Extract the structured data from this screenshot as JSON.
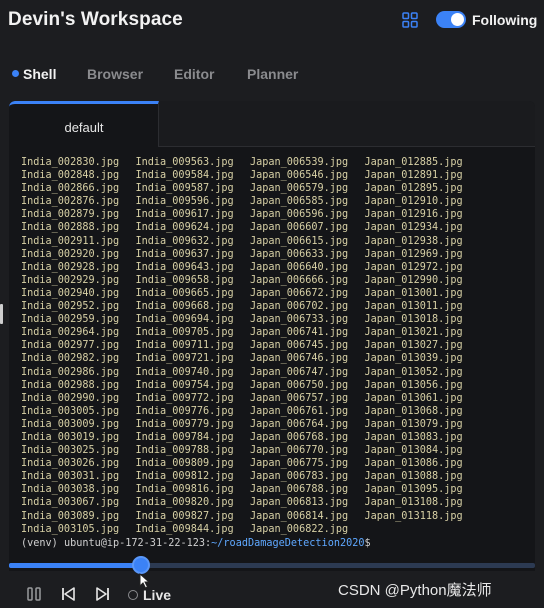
{
  "header": {
    "title": "Devin's Workspace",
    "following_label": "Following",
    "toggle_on": true,
    "icons": {
      "layout": "grid-icon"
    }
  },
  "tabs": [
    {
      "label": "Shell",
      "active": true
    },
    {
      "label": "Browser",
      "active": false
    },
    {
      "label": "Editor",
      "active": false
    },
    {
      "label": "Planner",
      "active": false
    }
  ],
  "terminal": {
    "tab_label": "default",
    "columns": [
      [
        "India_002830.jpg",
        "India_002848.jpg",
        "India_002866.jpg",
        "India_002876.jpg",
        "India_002879.jpg",
        "India_002888.jpg",
        "India_002911.jpg",
        "India_002920.jpg",
        "India_002928.jpg",
        "India_002929.jpg",
        "India_002940.jpg",
        "India_002952.jpg",
        "India_002959.jpg",
        "India_002964.jpg",
        "India_002977.jpg",
        "India_002982.jpg",
        "India_002986.jpg",
        "India_002988.jpg",
        "India_002990.jpg",
        "India_003005.jpg",
        "India_003009.jpg",
        "India_003019.jpg",
        "India_003025.jpg",
        "India_003026.jpg",
        "India_003031.jpg",
        "India_003038.jpg",
        "India_003067.jpg",
        "India_003089.jpg",
        "India_003105.jpg"
      ],
      [
        "India_009563.jpg",
        "India_009584.jpg",
        "India_009587.jpg",
        "India_009596.jpg",
        "India_009617.jpg",
        "India_009624.jpg",
        "India_009632.jpg",
        "India_009637.jpg",
        "India_009643.jpg",
        "India_009658.jpg",
        "India_009665.jpg",
        "India_009668.jpg",
        "India_009694.jpg",
        "India_009705.jpg",
        "India_009711.jpg",
        "India_009721.jpg",
        "India_009740.jpg",
        "India_009754.jpg",
        "India_009772.jpg",
        "India_009776.jpg",
        "India_009779.jpg",
        "India_009784.jpg",
        "India_009788.jpg",
        "India_009809.jpg",
        "India_009812.jpg",
        "India_009816.jpg",
        "India_009820.jpg",
        "India_009827.jpg",
        "India_009844.jpg"
      ],
      [
        "Japan_006539.jpg",
        "Japan_006546.jpg",
        "Japan_006579.jpg",
        "Japan_006585.jpg",
        "Japan_006596.jpg",
        "Japan_006607.jpg",
        "Japan_006615.jpg",
        "Japan_006633.jpg",
        "Japan_006640.jpg",
        "Japan_006666.jpg",
        "Japan_006672.jpg",
        "Japan_006702.jpg",
        "Japan_006733.jpg",
        "Japan_006741.jpg",
        "Japan_006745.jpg",
        "Japan_006746.jpg",
        "Japan_006747.jpg",
        "Japan_006750.jpg",
        "Japan_006757.jpg",
        "Japan_006761.jpg",
        "Japan_006764.jpg",
        "Japan_006768.jpg",
        "Japan_006770.jpg",
        "Japan_006775.jpg",
        "Japan_006783.jpg",
        "Japan_006788.jpg",
        "Japan_006813.jpg",
        "Japan_006814.jpg",
        "Japan_006822.jpg"
      ],
      [
        "Japan_012885.jpg",
        "Japan_012891.jpg",
        "Japan_012895.jpg",
        "Japan_012910.jpg",
        "Japan_012916.jpg",
        "Japan_012934.jpg",
        "Japan_012938.jpg",
        "Japan_012969.jpg",
        "Japan_012972.jpg",
        "Japan_012990.jpg",
        "Japan_013001.jpg",
        "Japan_013011.jpg",
        "Japan_013018.jpg",
        "Japan_013021.jpg",
        "Japan_013027.jpg",
        "Japan_013039.jpg",
        "Japan_013052.jpg",
        "Japan_013056.jpg",
        "Japan_013061.jpg",
        "Japan_013068.jpg",
        "Japan_013079.jpg",
        "Japan_013083.jpg",
        "Japan_013084.jpg",
        "Japan_013086.jpg",
        "Japan_013088.jpg",
        "Japan_013095.jpg",
        "Japan_013108.jpg",
        "Japan_013118.jpg",
        ""
      ]
    ],
    "prompt": {
      "venv": "(venv) ",
      "user_host": "ubuntu@ip-172-31-22-123",
      "separator": ":",
      "path": "~/roadDamageDetection2020",
      "symbol": "$"
    }
  },
  "playback": {
    "progress": 0.25,
    "live_label": "Live",
    "icons": {
      "pause": "pause-icon",
      "back": "skip-back-icon",
      "forward": "skip-forward-icon",
      "live": "live-dot-icon"
    }
  },
  "watermark": "CSDN @Python魔法师",
  "colors": {
    "accent": "#3b82f6",
    "background": "#1c1d20",
    "terminal_text": "#d7d0a5",
    "path": "#5fa8ff"
  }
}
